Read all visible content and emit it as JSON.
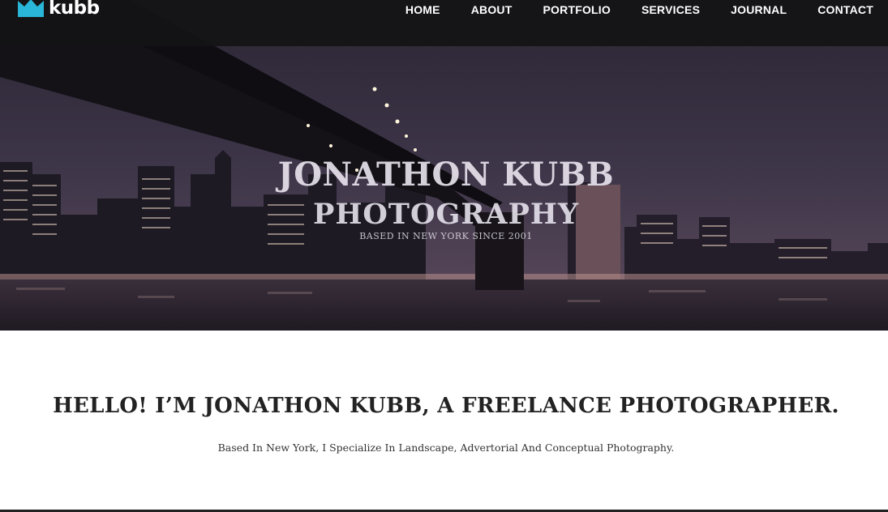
{
  "brand": {
    "name": "kubb",
    "logo_icon": "crown-icon",
    "accent_color": "#29b6d8"
  },
  "nav": {
    "items": [
      {
        "label": "HOME"
      },
      {
        "label": "ABOUT"
      },
      {
        "label": "PORTFOLIO"
      },
      {
        "label": "SERVICES"
      },
      {
        "label": "JOURNAL"
      },
      {
        "label": "CONTACT"
      }
    ]
  },
  "hero": {
    "title": "JONATHON KUBB",
    "subtitle": "PHOTOGRAPHY",
    "tagline": "BASED IN NEW YORK SINCE 2001",
    "image": "night-city-bridge-skyline"
  },
  "intro": {
    "heading": "HELLO! I’M JONATHON KUBB, A FREELANCE PHOTOGRAPHER.",
    "text": "Based In New York, I Specialize In Landscape, Advertorial And Conceptual Photography."
  }
}
